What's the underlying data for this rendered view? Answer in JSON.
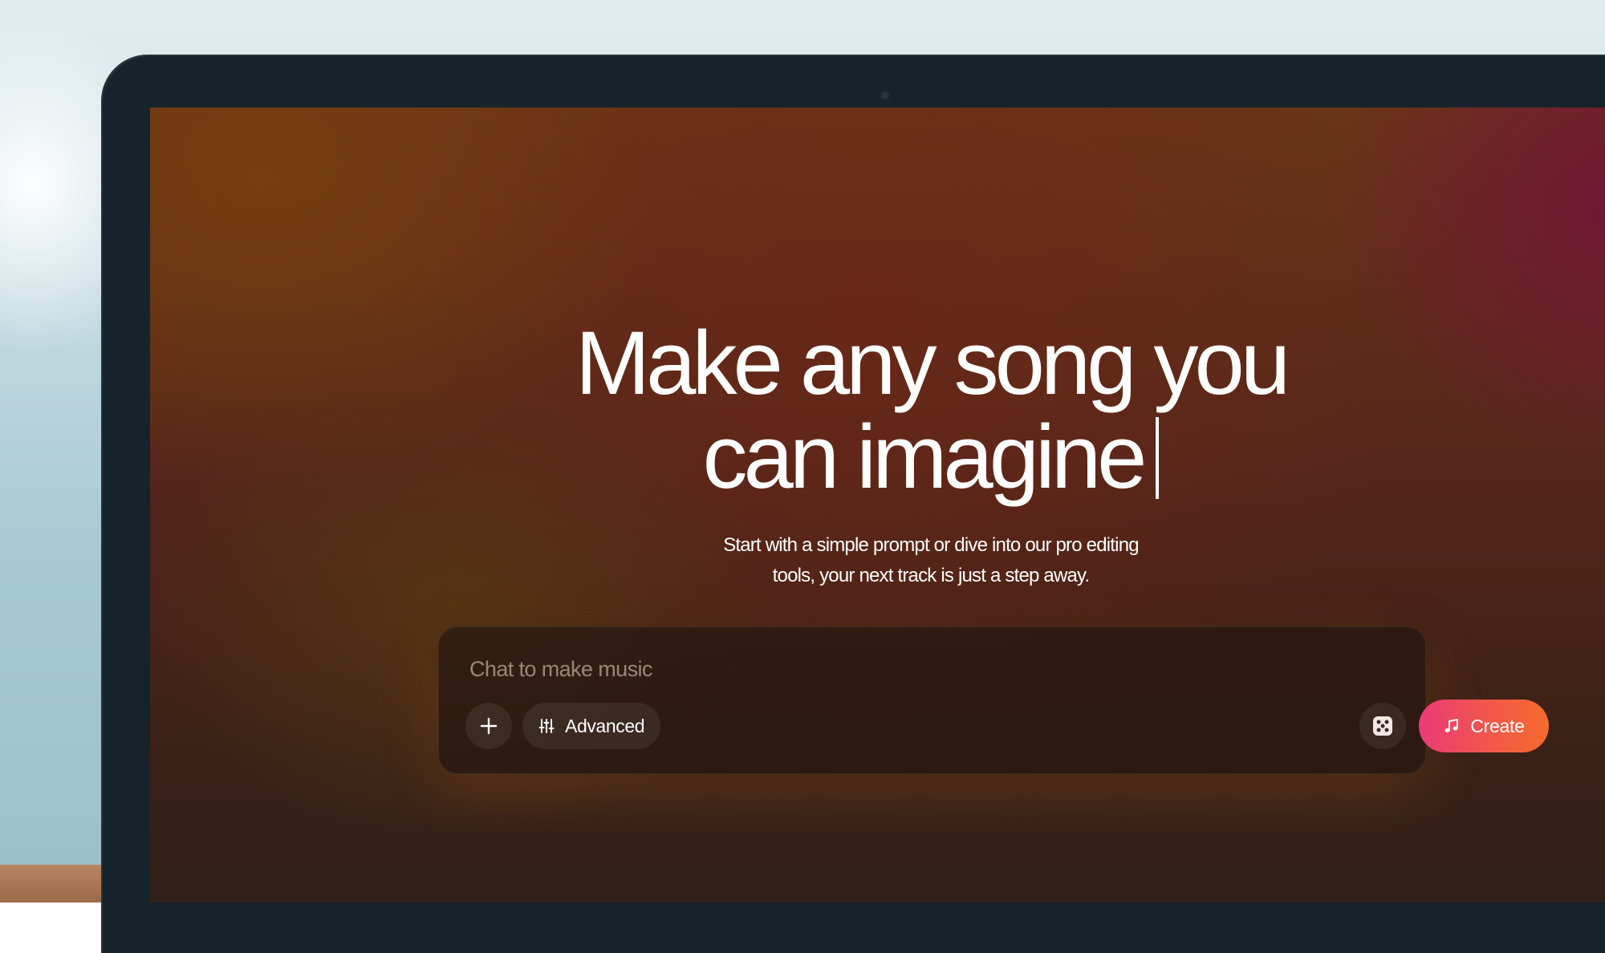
{
  "hero": {
    "title_line1": "Make any song you",
    "title_line2": "can imagine",
    "subtitle_line1": "Start with a simple prompt or dive into our pro editing",
    "subtitle_line2": "tools, your next track is just a step away."
  },
  "composer": {
    "placeholder": "Chat to make music",
    "value": "",
    "add_icon": "plus-icon",
    "advanced_icon": "sliders-icon",
    "advanced_label": "Advanced",
    "random_icon": "dice-icon",
    "create_icon": "music-note-icon",
    "create_label": "Create"
  },
  "colors": {
    "create_gradient_start": "#ea3b78",
    "create_gradient_end": "#f56a2d",
    "text": "#ffffff"
  }
}
